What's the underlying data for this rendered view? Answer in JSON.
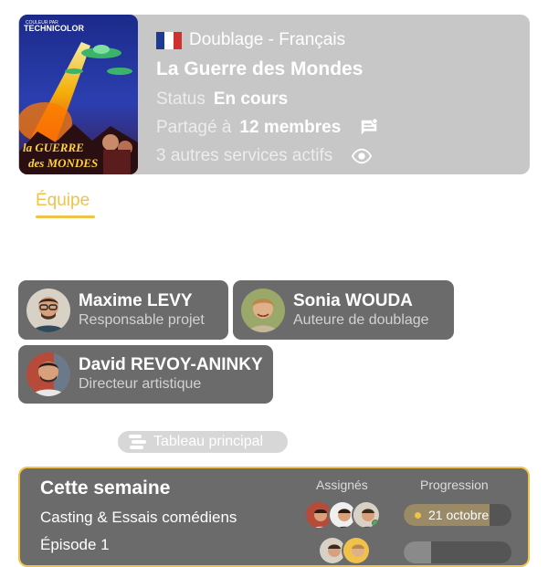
{
  "project": {
    "language": "Doublage - Français",
    "title": "La Guerre des Mondes",
    "status_label": "Status",
    "status_value": "En cours",
    "shared_label": "Partagé à",
    "shared_value": "12 membres",
    "services": "3 autres services actifs",
    "poster": {
      "brand_small": "COULEUR PAR",
      "brand": "TECHNICOLOR",
      "title_line1": "la GUERRE",
      "title_line2": "des MONDES"
    },
    "flag_colors": [
      "#1f3a93",
      "#ffffff",
      "#d0312d"
    ]
  },
  "tabs": [
    {
      "label": "Équipe",
      "active": true
    }
  ],
  "team": [
    {
      "name": "Maxime LEVY",
      "role": "Responsable projet"
    },
    {
      "name": "Sonia WOUDA",
      "role": "Auteure de doublage"
    },
    {
      "name": "David REVOY-ANINKY",
      "role": "Directeur artistique"
    }
  ],
  "board": {
    "label": "Tableau principal"
  },
  "week": {
    "title": "Cette semaine",
    "col_assignees": "Assignés",
    "col_progress": "Progression",
    "tasks": [
      {
        "label": "Casting & Essais comédiens",
        "progress_label": "21 octobre",
        "progress": 0.8
      },
      {
        "label": "Épisode 1",
        "progress_label": "",
        "progress": 0.25
      }
    ]
  },
  "colors": {
    "accent": "#f0c24a",
    "card": "#6b6b6b",
    "header": "#c7c7c7"
  }
}
